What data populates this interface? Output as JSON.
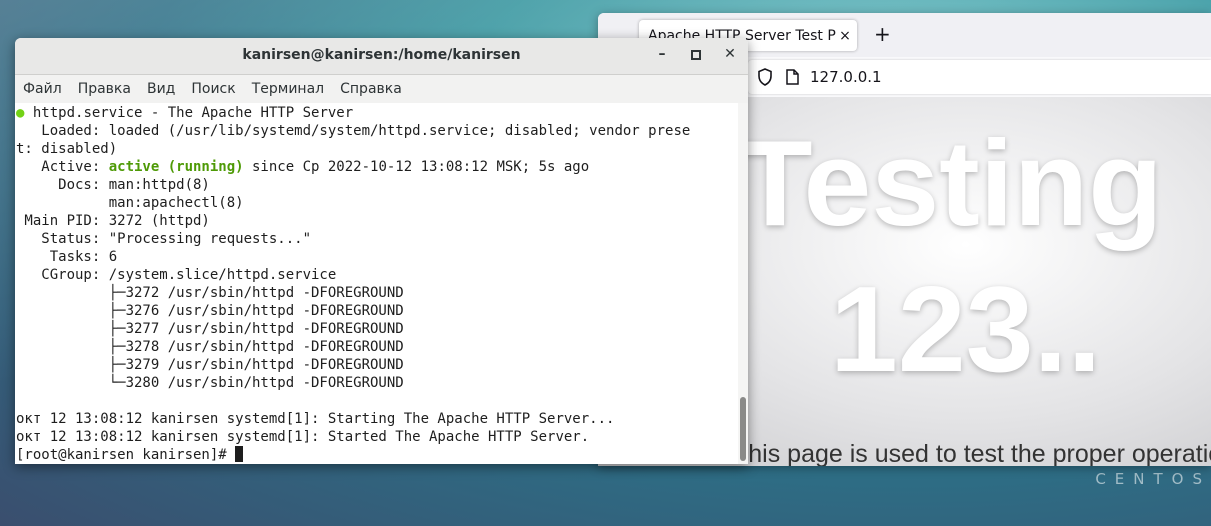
{
  "desktop": {
    "watermark": "CENTOS"
  },
  "browser": {
    "tab_title": "Apache HTTP Server Test Page",
    "url": "127.0.0.1",
    "page": {
      "heading_line1": "Testing",
      "heading_line2": "123..",
      "subtitle": "This page is used to test the proper operation"
    }
  },
  "terminal": {
    "title": "kanirsen@kanirsen:/home/kanirsen",
    "menu": [
      "Файл",
      "Правка",
      "Вид",
      "Поиск",
      "Терминал",
      "Справка"
    ],
    "lines": {
      "service": " httpd.service - The Apache HTTP Server",
      "loaded": "   Loaded: loaded (/usr/lib/systemd/system/httpd.service; disabled; vendor prese",
      "loaded_wrap": "t: disabled)",
      "active_prefix": "   Active: ",
      "active_status": "active (running)",
      "active_suffix": " since Ср 2022-10-12 13:08:12 MSK; 5s ago",
      "docs1": "     Docs: man:httpd(8)",
      "docs2": "           man:apachectl(8)",
      "main_pid": " Main PID: 3272 (httpd)",
      "status": "   Status: \"Processing requests...\"",
      "tasks": "    Tasks: 6",
      "cgroup": "   CGroup: /system.slice/httpd.service",
      "proc1": "           ├─3272 /usr/sbin/httpd -DFOREGROUND",
      "proc2": "           ├─3276 /usr/sbin/httpd -DFOREGROUND",
      "proc3": "           ├─3277 /usr/sbin/httpd -DFOREGROUND",
      "proc4": "           ├─3278 /usr/sbin/httpd -DFOREGROUND",
      "proc5": "           ├─3279 /usr/sbin/httpd -DFOREGROUND",
      "proc6": "           └─3280 /usr/sbin/httpd -DFOREGROUND",
      "log1": "окт 12 13:08:12 kanirsen systemd[1]: Starting The Apache HTTP Server...",
      "log2": "окт 12 13:08:12 kanirsen systemd[1]: Started The Apache HTTP Server.",
      "prompt": "[root@kanirsen kanirsen]# "
    }
  }
}
